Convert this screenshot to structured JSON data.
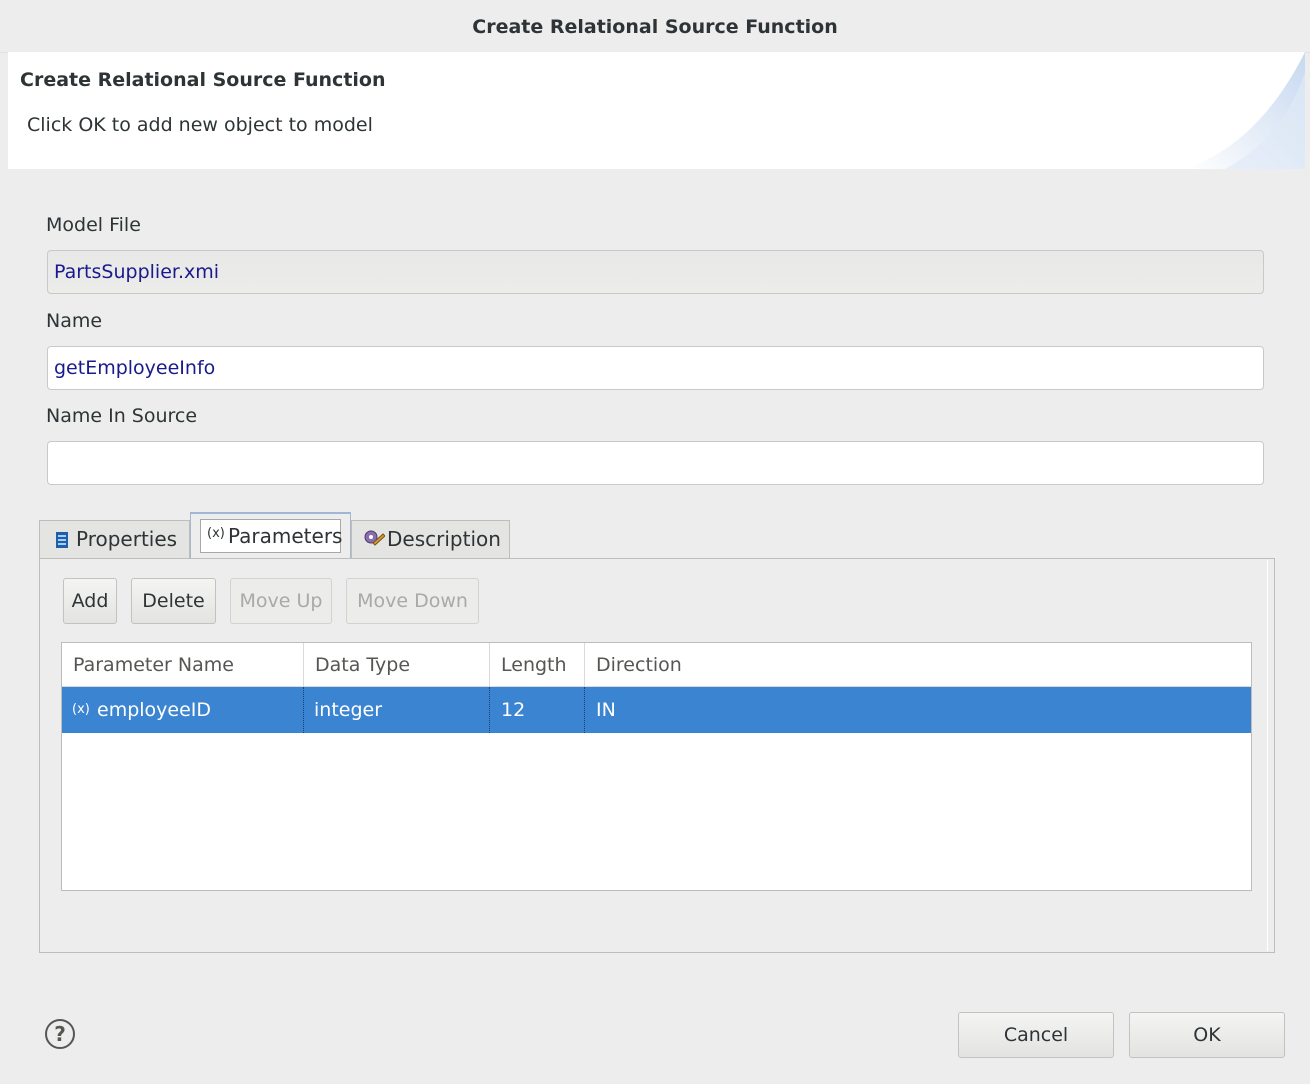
{
  "window": {
    "title": "Create Relational Source Function"
  },
  "banner": {
    "heading": "Create Relational Source Function",
    "message": "Click OK to add new object to model"
  },
  "fields": {
    "model_file": {
      "label": "Model File",
      "value": "PartsSupplier.xmi"
    },
    "name": {
      "label": "Name",
      "value": "getEmployeeInfo"
    },
    "name_in_source": {
      "label": "Name In Source",
      "value": ""
    }
  },
  "tabs": [
    {
      "label": "Properties",
      "icon": "properties-icon"
    },
    {
      "label": "Parameters",
      "icon": "parameter-icon"
    },
    {
      "label": "Description",
      "icon": "description-icon"
    }
  ],
  "active_tab": "Parameters",
  "toolbar": {
    "add": "Add",
    "delete": "Delete",
    "move_up": "Move Up",
    "move_down": "Move Down"
  },
  "table": {
    "columns": [
      "Parameter Name",
      "Data Type",
      "Length",
      "Direction"
    ],
    "rows": [
      {
        "name": "employeeID",
        "type": "integer",
        "length": "12",
        "direction": "IN",
        "icon": "parameter-icon"
      }
    ]
  },
  "footer": {
    "help": "?",
    "cancel": "Cancel",
    "ok": "OK"
  },
  "colors": {
    "selection": "#3b84d1",
    "field_text": "#1a1a8c"
  }
}
